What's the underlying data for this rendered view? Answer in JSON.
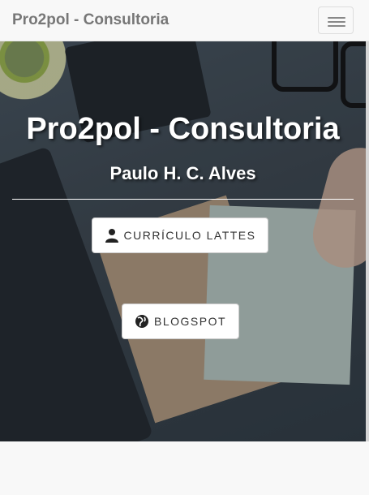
{
  "navbar": {
    "brand": "Pro2pol - Consultoria",
    "menu_icon": "hamburger-menu-icon"
  },
  "hero": {
    "title": "Pro2pol - Consultoria",
    "subtitle": "Paulo H. C. Alves"
  },
  "buttons": {
    "lattes": {
      "label": "CURRÍCULO LATTES",
      "icon": "user-icon"
    },
    "blog": {
      "label": "BLOGSPOT",
      "icon": "globe-icon"
    }
  }
}
